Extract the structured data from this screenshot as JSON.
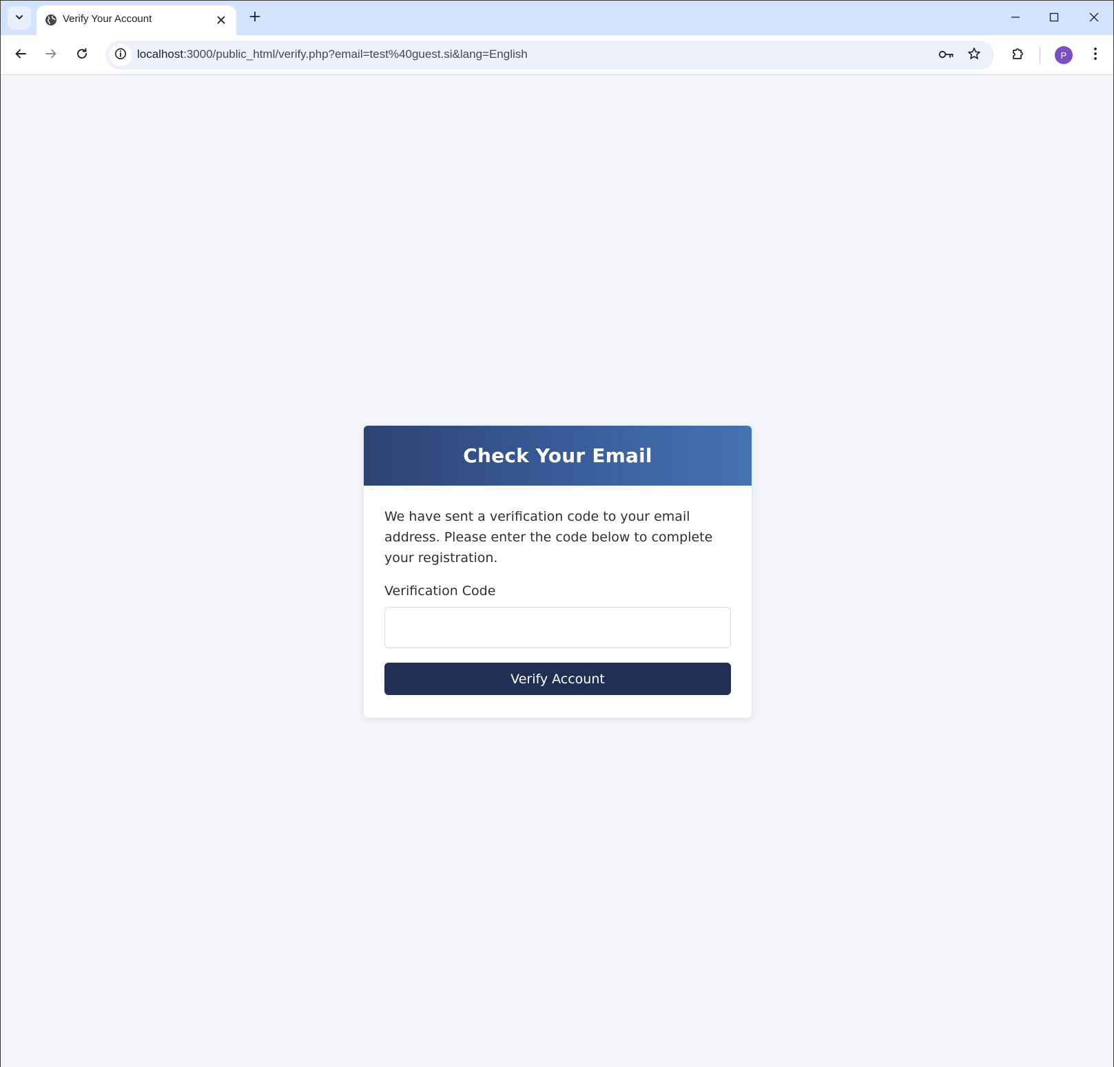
{
  "browser": {
    "tab": {
      "title": "Verify Your Account",
      "favicon_icon": "globe-icon"
    },
    "address_bar": {
      "url_host": "localhost",
      "url_rest": ":3000/public_html/verify.php?email=test%40guest.si&lang=English"
    },
    "profile": {
      "initial": "P",
      "color": "#7b4fc3"
    }
  },
  "card": {
    "title": "Check Your Email",
    "message": "We have sent a verification code to your email address. Please enter the code below to complete your registration.",
    "field_label": "Verification Code",
    "field_value": "",
    "field_placeholder": "",
    "button_label": "Verify Account"
  },
  "colors": {
    "page_background": "#f3f5f9",
    "header_gradient_start": "#2d4373",
    "header_gradient_end": "#4572b3",
    "button_background": "#213052"
  }
}
